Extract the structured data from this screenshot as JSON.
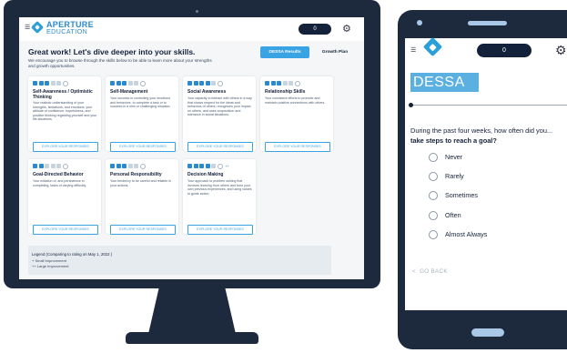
{
  "brand": {
    "name": "APERTURE",
    "sub": "EDUCATION"
  },
  "desktop": {
    "menu_icon": "hamburger-icon",
    "notification_count": "0",
    "settings_icon": "gear-icon",
    "headline": "Great work! Let's dive deeper into your skills.",
    "subtext": "We encourage you to browse through the skills below to be able to learn more about your strengths and growth opportunities.",
    "tabs": [
      "DESSA Results",
      "Growth Plan"
    ],
    "cards": [
      {
        "title": "Self-Awareness / Optimistic Thinking",
        "level": 3,
        "desc": "Your realistic understanding of your strengths, limitations, and emotions; your attitude of confidence, hopefulness, and positive thinking regarding yourself and your life situations.",
        "button": "EXPLORE YOUR RESPONSES"
      },
      {
        "title": "Self-Management",
        "level": 3,
        "desc": "Your success in controlling your emotions and behaviors, to complete a task or to succeed in a new or challenging situation.",
        "button": "EXPLORE YOUR RESPONSES"
      },
      {
        "title": "Social Awareness",
        "level": 4,
        "desc": "Your capacity to interact with others in a way that shows respect for the ideas and behaviors of others, recognizes your impact on others, and uses cooperation and tolerance in social situations.",
        "button": "EXPLORE YOUR RESPONSES"
      },
      {
        "title": "Relationship Skills",
        "level": 3,
        "desc": "Your consistent efforts to promote and maintain positive connections with others.",
        "button": "EXPLORE YOUR RESPONSES"
      },
      {
        "title": "Goal-Directed Behavior",
        "level": 2,
        "desc": "Your initiation of, and persistence in completing, tasks of varying difficulty.",
        "button": "EXPLORE YOUR RESPONSES"
      },
      {
        "title": "Personal Responsibility",
        "level": 3,
        "desc": "Your tendency to be careful and reliable in your actions.",
        "button": "EXPLORE YOUR RESPONSES"
      },
      {
        "title": "Decision Making",
        "level": 4,
        "desc": "Your approach to problem solving that involves learning from others and from your own previous experiences, and using values to guide action.",
        "button": "EXPLORE YOUR RESPONSES"
      }
    ],
    "legend": {
      "title": "Legend (Comparing to rating on May 1, 2022 )",
      "small": "+ Small Improvement",
      "large": "++ Large Improvement"
    }
  },
  "phone": {
    "notification_count": "0",
    "section": "DESSA",
    "question_line1": "During the past four weeks, how often did you...",
    "question_line2": "take steps to reach a goal?",
    "options": [
      "Never",
      "Rarely",
      "Sometimes",
      "Often",
      "Almost Always"
    ],
    "back": "GO BACK"
  },
  "colors": {
    "accent": "#3aa3e3",
    "navy": "#14213a",
    "bezel": "#1d2a3e"
  }
}
